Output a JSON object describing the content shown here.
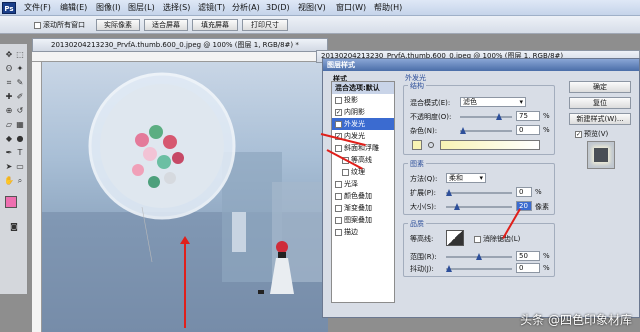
{
  "menubar": {
    "logo": "Ps",
    "items": [
      "文件(F)",
      "编辑(E)",
      "图像(I)",
      "图层(L)",
      "选择(S)",
      "滤镜(T)",
      "分析(A)",
      "3D(D)",
      "视图(V)",
      "窗口(W)",
      "帮助(H)"
    ]
  },
  "options": {
    "scroll_all": "滚动所有窗口",
    "actual_pixels": "实际像素",
    "fit_screen": "适合屏幕",
    "fill_screen": "填充屏幕",
    "print_size": "打印尺寸"
  },
  "canvas": {
    "tab_title": "20130204213230_PrvfA.thumb.600_0.jpeg @ 100% (图层 1, RGB/8#) *"
  },
  "doc2": {
    "tab_title": "20130204213230_PrvfA.thumb.600_0.jpeg @ 100% (图层 1, RGB/8#)"
  },
  "dialog": {
    "title": "图层样式",
    "styles_header": "样式",
    "blend_options": "混合选项:默认",
    "styles": [
      {
        "label": "投影",
        "checked": false
      },
      {
        "label": "内阴影",
        "checked": true
      },
      {
        "label": "外发光",
        "checked": true
      },
      {
        "label": "内发光",
        "checked": true
      },
      {
        "label": "斜面和浮雕",
        "checked": false
      },
      {
        "label": "等高线",
        "checked": false
      },
      {
        "label": "纹理",
        "checked": false
      },
      {
        "label": "光泽",
        "checked": false
      },
      {
        "label": "颜色叠加",
        "checked": false
      },
      {
        "label": "渐变叠加",
        "checked": false
      },
      {
        "label": "图案叠加",
        "checked": false
      },
      {
        "label": "描边",
        "checked": false
      }
    ],
    "section_title": "外发光",
    "structure": {
      "title": "结构",
      "blend_mode_label": "混合模式(E):",
      "blend_mode_value": "滤色",
      "opacity_label": "不透明度(O):",
      "opacity_value": "75",
      "noise_label": "杂色(N):",
      "noise_value": "0",
      "pct": "%"
    },
    "elements": {
      "title": "图素",
      "method_label": "方法(Q):",
      "method_value": "柔和",
      "spread_label": "扩展(P):",
      "spread_value": "0",
      "size_label": "大小(S):",
      "size_value": "20",
      "size_unit": "像素",
      "pct": "%"
    },
    "quality": {
      "title": "品质",
      "contour_label": "等高线:",
      "antialias_label": "消除锯齿(L)",
      "range_label": "范围(R):",
      "range_value": "50",
      "jitter_label": "抖动(J):",
      "jitter_value": "0",
      "pct": "%"
    },
    "buttons": {
      "ok": "确定",
      "reset": "复位",
      "new_style": "新建样式(W)...",
      "preview": "预览(V)"
    }
  },
  "watermark": "头条 @四色印象材库"
}
